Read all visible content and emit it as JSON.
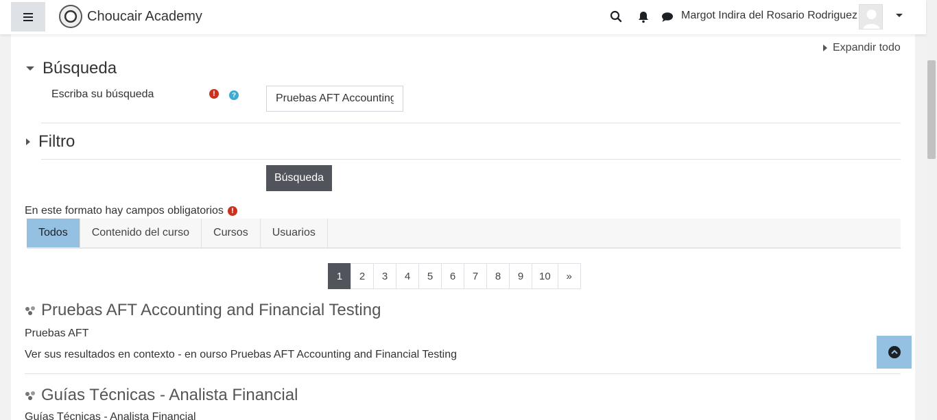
{
  "navbar": {
    "brand": "Choucair Academy",
    "user_name": "Margot Indira del Rosario Rodriguez"
  },
  "page": {
    "expand_all": "Expandir todo",
    "search_section": "Búsqueda",
    "field_label": "Escriba su búsqueda",
    "search_value": "Pruebas AFT Accounting",
    "filter_section": "Filtro",
    "submit_label": "Búsqueda",
    "required_note": "En este formato hay campos obligatorios"
  },
  "tabs": [
    {
      "label": "Todos",
      "active": true
    },
    {
      "label": "Contenido del curso",
      "active": false
    },
    {
      "label": "Cursos",
      "active": false
    },
    {
      "label": "Usuarios",
      "active": false
    }
  ],
  "pagination": [
    "1",
    "2",
    "3",
    "4",
    "5",
    "6",
    "7",
    "8",
    "9",
    "10",
    "»"
  ],
  "results": [
    {
      "title": "Pruebas AFT Accounting and Financial Testing",
      "subtitle": "Pruebas AFT",
      "context": "Ver sus resultados en contexto - en ourso Pruebas AFT Accounting and Financial Testing"
    },
    {
      "title": "Guías Técnicas - Analista Financial",
      "subtitle": "Guías Técnicas - Analista Financial"
    }
  ],
  "colors": {
    "active_tab": "#94c0e2",
    "dark_button": "#51545a",
    "required": "#ca3120",
    "help": "#3fa9d6"
  }
}
